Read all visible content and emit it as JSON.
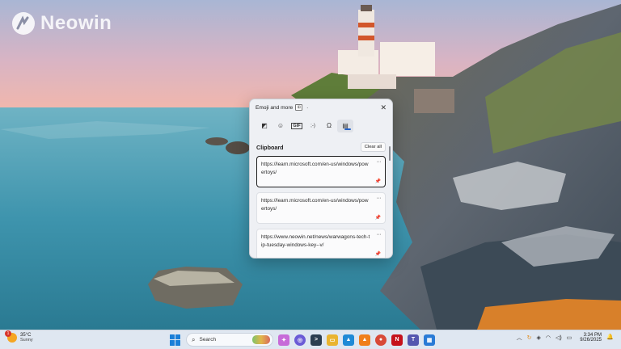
{
  "watermark": {
    "brand": "Neowin"
  },
  "flyout": {
    "title": "Emoji and more",
    "close_glyph": "✕",
    "tabs": [
      {
        "icon": "pin-sticker-icon",
        "glyph": "◩"
      },
      {
        "icon": "emoji-icon",
        "glyph": "☺"
      },
      {
        "icon": "gif-icon",
        "glyph": "GIF"
      },
      {
        "icon": "kaomoji-icon",
        "glyph": ";-)"
      },
      {
        "icon": "symbols-icon",
        "glyph": "Ω"
      },
      {
        "icon": "clipboard-icon",
        "glyph": "▤"
      }
    ],
    "section_label": "Clipboard",
    "clear_all": "Clear all",
    "items": [
      {
        "text": "https://learn.microsoft.com/en-us/windows/powertoys/",
        "more": "···",
        "selected": true
      },
      {
        "text": "https://learn.microsoft.com/en-us/windows/powertoys/",
        "more": "···",
        "selected": false
      },
      {
        "text": "https://www.neowin.net/news/warwagons-tech-tip-tuesday-windows-key--v/",
        "more": "···",
        "selected": false
      }
    ]
  },
  "taskbar": {
    "weather": {
      "badge": "1",
      "temp": "35°C",
      "desc": "Sunny"
    },
    "search_placeholder": "Search",
    "apps": [
      {
        "name": "copilot-icon",
        "color": "#c76bd8",
        "glyph": "✦"
      },
      {
        "name": "chatgpt-icon",
        "color": "#6b5bd6",
        "glyph": "◎"
      },
      {
        "name": "terminal-icon",
        "color": "#2c3e50",
        "glyph": ">"
      },
      {
        "name": "file-explorer-icon",
        "color": "#e9b430",
        "glyph": "▭"
      },
      {
        "name": "photos-icon",
        "color": "#1f8ad6",
        "glyph": "▲"
      },
      {
        "name": "vlc-icon",
        "color": "#f07f1a",
        "glyph": "▲"
      },
      {
        "name": "chrome-icon",
        "color": "#d84a38",
        "glyph": "●"
      },
      {
        "name": "netflix-icon",
        "color": "#c5121b",
        "glyph": "N"
      },
      {
        "name": "teams-icon",
        "color": "#5558af",
        "glyph": "T"
      },
      {
        "name": "store-icon",
        "color": "#2a7bd6",
        "glyph": "▦"
      }
    ],
    "tray": {
      "time": "3:34 PM",
      "date": "9/26/2025"
    }
  },
  "colors": {
    "accent": "#2563c9",
    "taskbar_bg": "#dfe7f1",
    "flyout_bg": "#eef0f4"
  }
}
